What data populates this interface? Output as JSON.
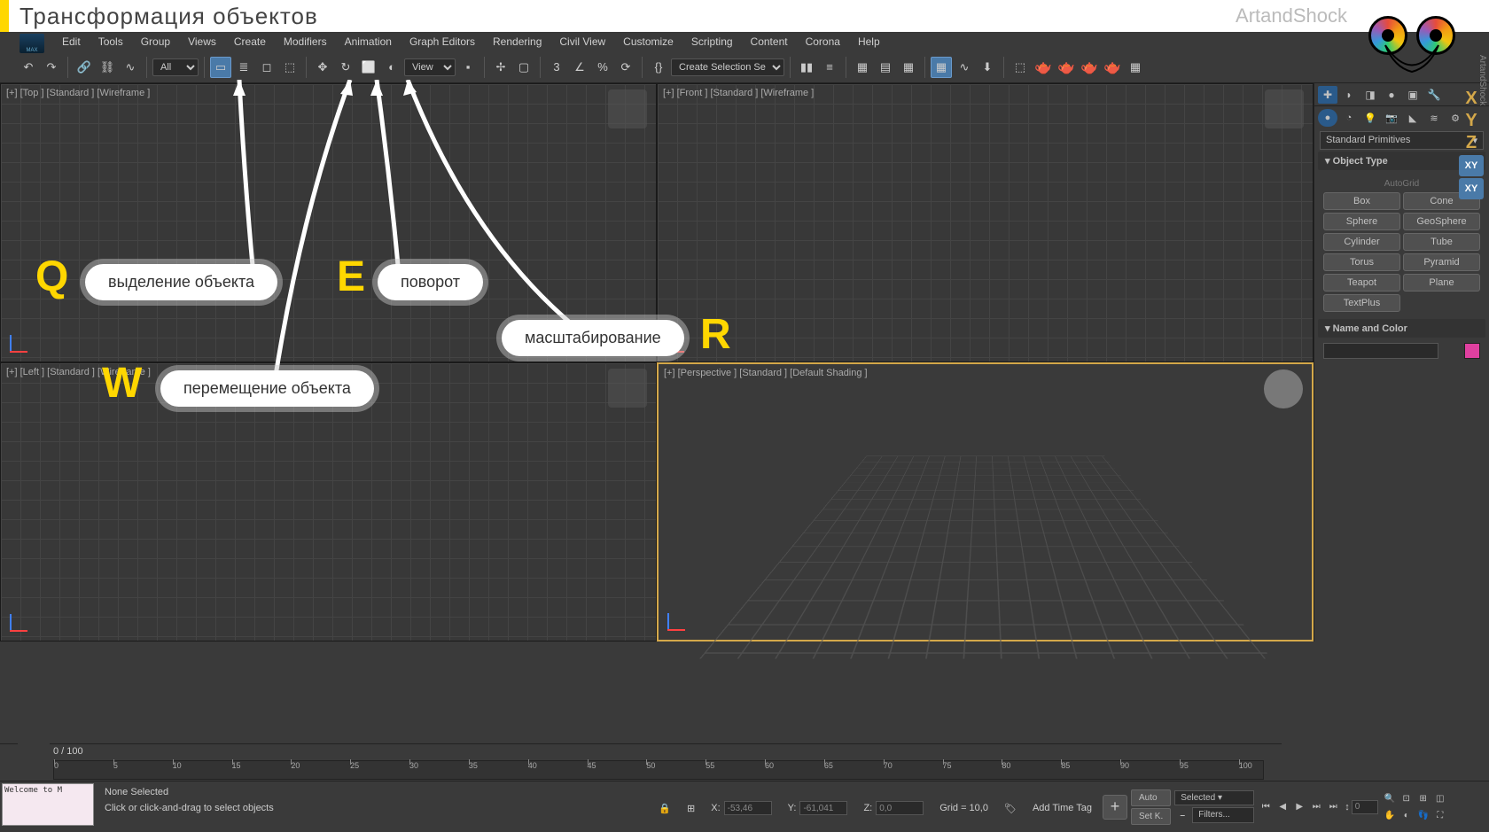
{
  "header": {
    "title": "Трансформация объектов",
    "brand": "ArtandShock",
    "vertText": "ArtandShock"
  },
  "menu": [
    "Edit",
    "Tools",
    "Group",
    "Views",
    "Create",
    "Modifiers",
    "Animation",
    "Graph Editors",
    "Rendering",
    "Civil View",
    "Customize",
    "Scripting",
    "Content",
    "Corona",
    "Help"
  ],
  "toolbar": {
    "filterSelect": "All",
    "refSelect": "View",
    "selectionSet": "Create Selection Set"
  },
  "viewports": {
    "topLeft": "[+] [Top ] [Standard ] [Wireframe ]",
    "topRight": "[+] [Front ] [Standard ] [Wireframe ]",
    "bottomLeft": "[+] [Left ] [Standard ] [Wireframe ]",
    "bottomRight": "[+] [Perspective ] [Standard ] [Default Shading ]"
  },
  "commandPanel": {
    "dropdown": "Standard Primitives",
    "objectType": "Object Type",
    "autogrid": "AutoGrid",
    "buttons": [
      "Box",
      "Cone",
      "Sphere",
      "GeoSphere",
      "Cylinder",
      "Tube",
      "Torus",
      "Pyramid",
      "Teapot",
      "Plane",
      "TextPlus"
    ],
    "nameColor": "Name and Color"
  },
  "axisLetters": [
    "X",
    "Y",
    "Z",
    "XY",
    "XY"
  ],
  "timeline": {
    "counter": "0 / 100",
    "ticks": [
      0,
      5,
      10,
      15,
      20,
      25,
      30,
      35,
      40,
      45,
      50,
      55,
      60,
      65,
      70,
      75,
      80,
      85,
      90,
      95,
      100
    ]
  },
  "status": {
    "maxscript": "Welcome to M",
    "none": "None Selected",
    "hint": "Click or click-and-drag to select objects",
    "x": "-53,46",
    "y": "-61,041",
    "z": "0,0",
    "grid": "Grid = 10,0",
    "addTag": "Add Time Tag",
    "auto": "Auto",
    "setk": "Set K.",
    "selected": "Selected",
    "filters": "Filters...",
    "spin": "0"
  },
  "annotations": {
    "q": {
      "key": "Q",
      "label": "выделение объекта"
    },
    "w": {
      "key": "W",
      "label": "перемещение объекта"
    },
    "e": {
      "key": "E",
      "label": "поворот"
    },
    "r": {
      "key": "R",
      "label": "масштабирование"
    }
  }
}
